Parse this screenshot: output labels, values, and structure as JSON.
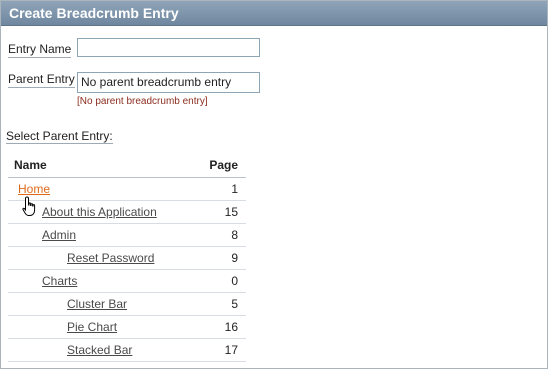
{
  "region": {
    "title": "Create Breadcrumb Entry"
  },
  "form": {
    "entry_name_label": "Entry Name",
    "entry_name_value": "",
    "parent_entry_label": "Parent Entry",
    "parent_entry_value": "No parent breadcrumb entry",
    "parent_entry_hint": "[No parent breadcrumb entry]"
  },
  "select_parent_label": "Select Parent Entry:",
  "table": {
    "columns": [
      "Name",
      "Page"
    ],
    "rows": [
      {
        "name": "Home",
        "page": "1"
      },
      {
        "name": "About this Application",
        "page": "15"
      },
      {
        "name": "Admin",
        "page": "8"
      },
      {
        "name": "Reset Password",
        "page": "9"
      },
      {
        "name": "Charts",
        "page": "0"
      },
      {
        "name": "Cluster Bar",
        "page": "5"
      },
      {
        "name": "Pie Chart",
        "page": "16"
      },
      {
        "name": "Stacked Bar",
        "page": "17"
      }
    ]
  },
  "icons": {
    "cursor": "hand-pointer-icon"
  },
  "colors": {
    "header_bg": "#7d93a9",
    "active_link": "#e06a1a",
    "hint_text": "#8b2e1f"
  }
}
